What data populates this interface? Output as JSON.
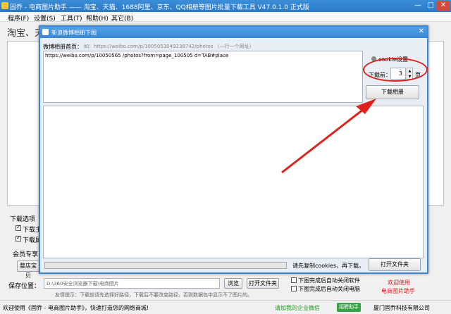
{
  "window": {
    "title": "固乔 - 电商图片助手 —— 淘宝、天猫、1688阿里、京东、QQ相册等图片批量下载工具 V47.0.1.0 正式版",
    "minimize": "—",
    "maximize": "□",
    "close": "✕"
  },
  "menu": [
    "程序(F)",
    "设置(S)",
    "工具(T)",
    "帮助(H)",
    "其它(B)"
  ],
  "background": {
    "heading": "淘宝、天",
    "download_options_label": "下载选项",
    "option1": "下载主",
    "option2": "下载属",
    "member_label": "会员专享",
    "member_btn": "整店宝贝",
    "save_label": "保存位置：",
    "save_path": "D:\\360安全浏览器下载\\电商图片",
    "browse_btn": "浏览",
    "open_folder_btn": "打开文件夹",
    "hint": "友情提示：下载前请先选择好路径，下载后不要改变路径，否则数据包中显示不了图片的。",
    "chk_close_software": "下图完成后自动关闭软件",
    "chk_close_pc": "下图完成后自动关闭电脑",
    "welcome1": "欢迎使用",
    "welcome2": "电商图片助手"
  },
  "dialog": {
    "title": "新浪微博相册下图",
    "close": "✕",
    "url_label": "微博相册首页：",
    "url_example": "如：https://weibo.com/p/1005053049238742/photos （一行一个网址）",
    "url_value": "https://weibo.com/p/10050565          /photos?from=page_100505      d=TAB#place",
    "cookie_label": "cookie设置",
    "pages_label": "下载前：",
    "pages_value": "3",
    "pages_unit": "页",
    "download_btn": "下载相册",
    "status_text": "请先复制cookies，再下载。",
    "open_folder_btn": "打开文件夹"
  },
  "statusbar": {
    "left": "欢迎使用《固乔 - 电商图片助手》，快速打造您的网络商城!",
    "middle": "请加我的企业微信",
    "badge": "招聘助手",
    "right": "厦门固乔科技有限公司"
  },
  "colors": {
    "titlebar": "#2b79c6",
    "dialog_border": "#3b87d4",
    "annotation_red": "#e0201a",
    "status_green": "#1a9c1a",
    "welcome_red": "#e02020"
  }
}
